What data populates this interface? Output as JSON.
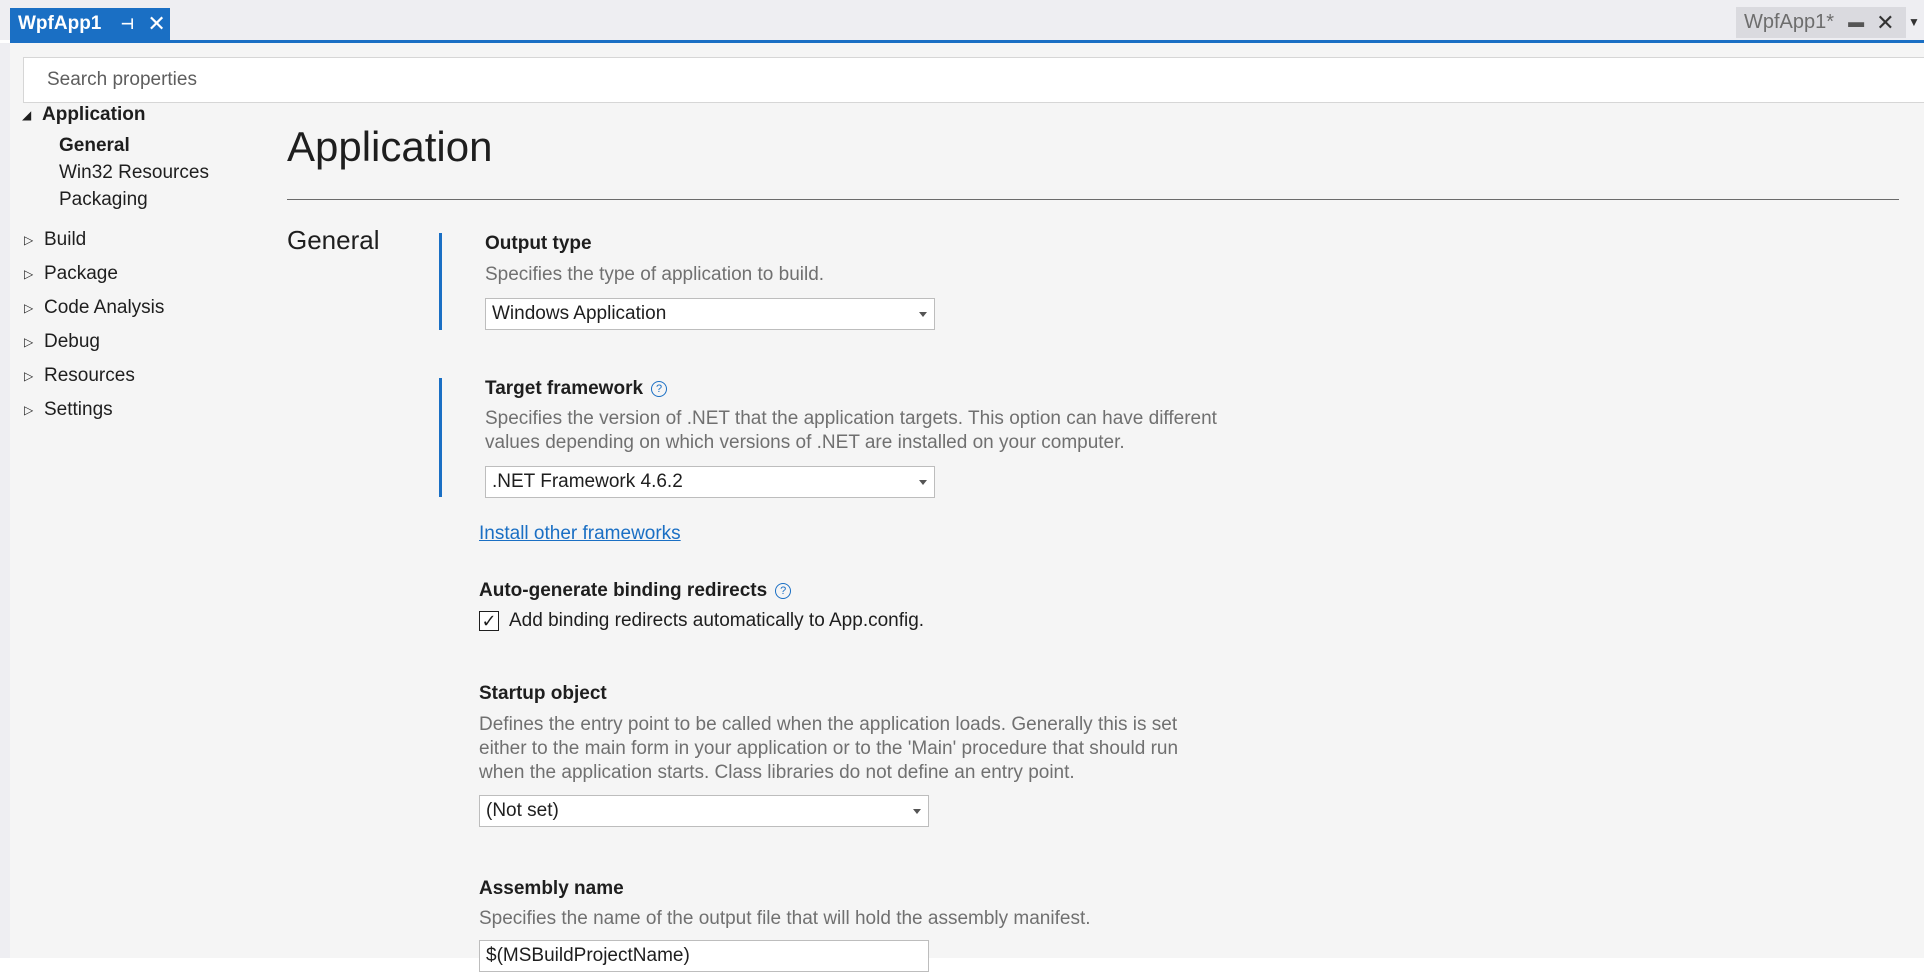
{
  "tabs": {
    "active": {
      "title": "WpfApp1",
      "pin_icon": "pin-icon",
      "close_icon": "close-icon"
    },
    "right": {
      "title": "WpfApp1*",
      "pin_icon": "pin-icon",
      "close_icon": "close-icon"
    }
  },
  "search": {
    "placeholder": "Search properties"
  },
  "nav": {
    "groups": [
      {
        "label": "Application",
        "expanded": true,
        "children": [
          "General",
          "Win32 Resources",
          "Packaging"
        ]
      },
      {
        "label": "Build",
        "expanded": false
      },
      {
        "label": "Package",
        "expanded": false
      },
      {
        "label": "Code Analysis",
        "expanded": false
      },
      {
        "label": "Debug",
        "expanded": false
      },
      {
        "label": "Resources",
        "expanded": false
      },
      {
        "label": "Settings",
        "expanded": false
      }
    ],
    "selected": "General"
  },
  "page": {
    "title": "Application",
    "section": "General",
    "output_type": {
      "label": "Output type",
      "description": "Specifies the type of application to build.",
      "value": "Windows Application"
    },
    "target_framework": {
      "label": "Target framework",
      "description_line1": "Specifies the version of .NET that the application targets. This option can have different",
      "description_line2": "values depending on which versions of .NET are installed on your computer.",
      "value": ".NET Framework 4.6.2",
      "link": "Install other frameworks"
    },
    "binding_redirects": {
      "label": "Auto-generate binding redirects",
      "checkbox_label": "Add binding redirects automatically to App.config.",
      "checked": true
    },
    "startup_object": {
      "label": "Startup object",
      "description_line1": "Defines the entry point to be called when the application loads. Generally this is set",
      "description_line2": "either to the main form in your application or to the 'Main' procedure that should run",
      "description_line3": "when the application starts. Class libraries do not define an entry point.",
      "value": "(Not set)"
    },
    "assembly_name": {
      "label": "Assembly name",
      "description": "Specifies the name of the output file that will hold the assembly manifest.",
      "value": "$(MSBuildProjectName)"
    }
  },
  "colors": {
    "accent": "#1a6fc4",
    "background": "#f5f5f5",
    "tab_bar": "#eeeef2"
  }
}
